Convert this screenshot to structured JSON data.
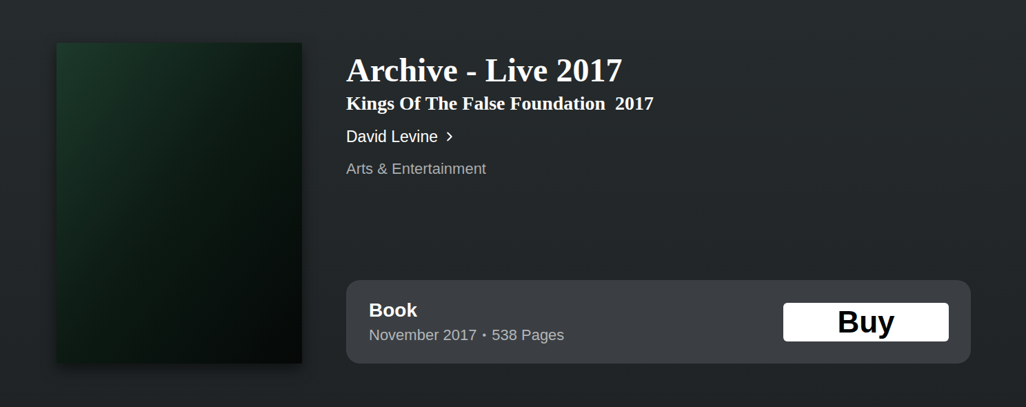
{
  "book": {
    "title": "Archive - Live 2017",
    "subtitle": "Kings Of The False Foundation  2017",
    "author": "David Levine",
    "category": "Arts & Entertainment"
  },
  "format": {
    "label": "Book",
    "date": "November 2017",
    "separator": "•",
    "pages": "538 Pages"
  },
  "buy_button": {
    "label": "Buy"
  }
}
